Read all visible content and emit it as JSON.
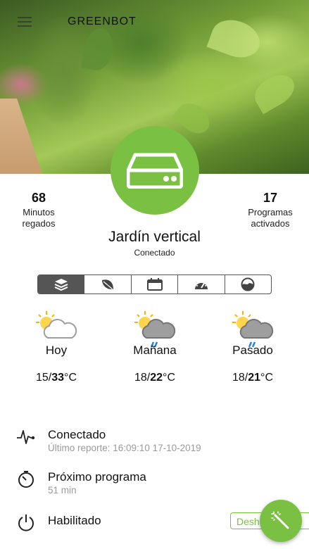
{
  "header": {
    "brand": "GREENBOT"
  },
  "stats": {
    "left": {
      "value": "68",
      "label_line1": "Minutos",
      "label_line2": "regados"
    },
    "right": {
      "value": "17",
      "label_line1": "Programas",
      "label_line2": "activados"
    }
  },
  "garden": {
    "name": "Jardín vertical",
    "status": "Conectado"
  },
  "tabs": [
    {
      "icon": "layers-icon",
      "active": true
    },
    {
      "icon": "leaf-icon",
      "active": false
    },
    {
      "icon": "calendar-icon",
      "active": false
    },
    {
      "icon": "gauge-icon",
      "active": false
    },
    {
      "icon": "humidity-icon",
      "active": false
    }
  ],
  "forecast": [
    {
      "day": "Hoy",
      "min": "15/",
      "max": "33",
      "unit": "°C",
      "icon": "partly-cloudy-icon"
    },
    {
      "day": "Mañana",
      "min": "18/",
      "max": "22",
      "unit": "°C",
      "icon": "cloud-rain-icon"
    },
    {
      "day": "Pasado",
      "min": "18/",
      "max": "21",
      "unit": "°C",
      "icon": "cloud-rain-icon"
    }
  ],
  "info": {
    "connection": {
      "title": "Conectado",
      "detail": "Último reporte: 16:09:10 17-10-2019"
    },
    "next_program": {
      "title": "Próximo programa",
      "detail": "51 min"
    },
    "enabled": {
      "title": "Habilitado",
      "button": "Deshabilitar"
    }
  },
  "colors": {
    "accent": "#7ac143",
    "text": "#111111",
    "muted": "#9a9a9a"
  }
}
